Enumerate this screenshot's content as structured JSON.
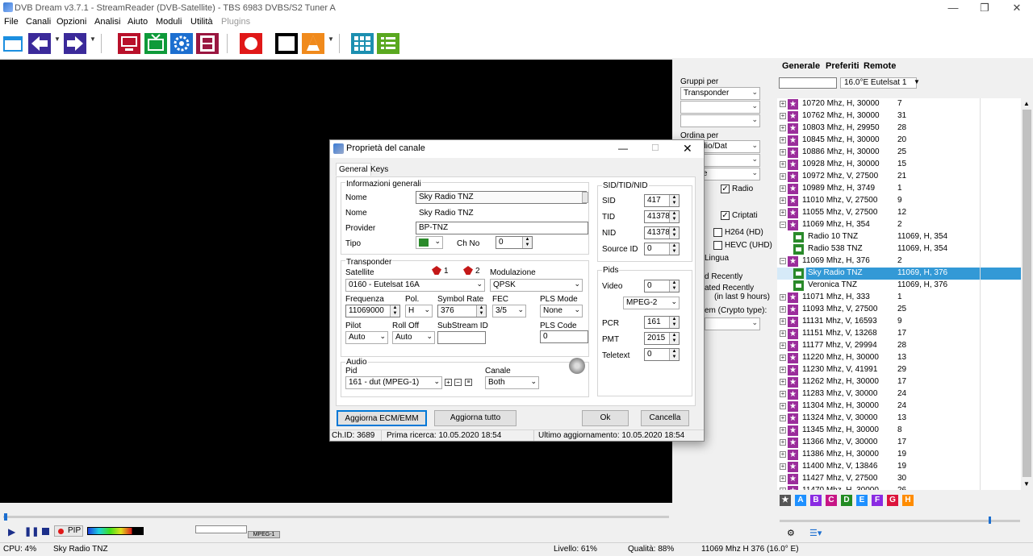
{
  "window": {
    "title": "DVB Dream v3.7.1 - StreamReader (DVB-Satellite) - TBS 6983 DVBS/S2 Tuner A"
  },
  "menu": [
    "File",
    "Canali",
    "Opzioni",
    "Analisi",
    "Aiuto",
    "Moduli",
    "Utilità",
    "Plugins"
  ],
  "midpanel": {
    "gruppi_label": "Gruppi per",
    "gruppi_value": "Transponder",
    "ordina_label": "Ordina per",
    "ordina_value": "V/Radio/Dat",
    "sort2": "canale",
    "radio_label": "Radio",
    "criptati_label": "Criptati",
    "h264_label": "H264 (HD)",
    "hevc_label": "HEVC (UHD)",
    "lingua": "Lingua",
    "added_recently": "d Recently",
    "updated_recently": "ated Recently",
    "last_hours": "(in last 9 hours)",
    "crypto_type": "em (Crypto type):"
  },
  "right_panel": {
    "tabs": [
      "Generale",
      "Preferiti",
      "Remote"
    ],
    "satellite": "16.0°E Eutelsat 1",
    "rows": [
      {
        "type": "tp",
        "name": "10720 Mhz, H, 30000",
        "val": "7"
      },
      {
        "type": "tp",
        "name": "10762 Mhz, H, 30000",
        "val": "31"
      },
      {
        "type": "tp",
        "name": "10803 Mhz, H, 29950",
        "val": "28"
      },
      {
        "type": "tp",
        "name": "10845 Mhz, H, 30000",
        "val": "20"
      },
      {
        "type": "tp",
        "name": "10886 Mhz, H, 30000",
        "val": "25"
      },
      {
        "type": "tp",
        "name": "10928 Mhz, H, 30000",
        "val": "15"
      },
      {
        "type": "tp",
        "name": "10972 Mhz, V, 27500",
        "val": "21"
      },
      {
        "type": "tp",
        "name": "10989 Mhz, H, 3749",
        "val": "1"
      },
      {
        "type": "tp",
        "name": "11010 Mhz, V, 27500",
        "val": "9"
      },
      {
        "type": "tp",
        "name": "11055 Mhz, V, 27500",
        "val": "12"
      },
      {
        "type": "tpo",
        "name": "11069 Mhz, H, 354",
        "val": "2"
      },
      {
        "type": "ch",
        "name": "Radio 10 TNZ",
        "val": "11069, H, 354"
      },
      {
        "type": "ch",
        "name": "Radio 538 TNZ",
        "val": "11069, H, 354"
      },
      {
        "type": "tpo",
        "name": "11069 Mhz, H, 376",
        "val": "2"
      },
      {
        "type": "chs",
        "name": "Sky Radio TNZ",
        "val": "11069, H, 376"
      },
      {
        "type": "ch",
        "name": "Veronica TNZ",
        "val": "11069, H, 376"
      },
      {
        "type": "tp",
        "name": "11071 Mhz, H, 333",
        "val": "1"
      },
      {
        "type": "tp",
        "name": "11093 Mhz, V, 27500",
        "val": "25"
      },
      {
        "type": "tp",
        "name": "11131 Mhz, V, 16593",
        "val": "9"
      },
      {
        "type": "tp",
        "name": "11151 Mhz, V, 13268",
        "val": "17"
      },
      {
        "type": "tp",
        "name": "11177 Mhz, V, 29994",
        "val": "28"
      },
      {
        "type": "tp",
        "name": "11220 Mhz, H, 30000",
        "val": "13"
      },
      {
        "type": "tp",
        "name": "11230 Mhz, V, 41991",
        "val": "29"
      },
      {
        "type": "tp",
        "name": "11262 Mhz, H, 30000",
        "val": "17"
      },
      {
        "type": "tp",
        "name": "11283 Mhz, V, 30000",
        "val": "24"
      },
      {
        "type": "tp",
        "name": "11304 Mhz, H, 30000",
        "val": "24"
      },
      {
        "type": "tp",
        "name": "11324 Mhz, V, 30000",
        "val": "13"
      },
      {
        "type": "tp",
        "name": "11345 Mhz, H, 30000",
        "val": "8"
      },
      {
        "type": "tp",
        "name": "11366 Mhz, V, 30000",
        "val": "17"
      },
      {
        "type": "tp",
        "name": "11386 Mhz, H, 30000",
        "val": "19"
      },
      {
        "type": "tp",
        "name": "11400 Mhz, V, 13846",
        "val": "19"
      },
      {
        "type": "tp",
        "name": "11427 Mhz, V, 27500",
        "val": "30"
      },
      {
        "type": "tp",
        "name": "11470 Mhz, H, 30000",
        "val": "26"
      }
    ],
    "letters": [
      {
        "l": "A",
        "c": "#1e90ff"
      },
      {
        "l": "B",
        "c": "#8a2be2"
      },
      {
        "l": "C",
        "c": "#c71585"
      },
      {
        "l": "D",
        "c": "#228b22"
      },
      {
        "l": "E",
        "c": "#1e90ff"
      },
      {
        "l": "F",
        "c": "#8a2be2"
      },
      {
        "l": "G",
        "c": "#dc143c"
      },
      {
        "l": "H",
        "c": "#ff8c00"
      }
    ]
  },
  "dialog": {
    "title": "Proprietà del canale",
    "tab_general": "General",
    "tab_keys": "Keys",
    "info_title": "Informazioni generali",
    "nome_label": "Nome",
    "nome_value": "Sky Radio TNZ",
    "nome2_label": "Nome",
    "nome2_value": "Sky Radio TNZ",
    "provider_label": "Provider",
    "provider_value": "BP-TNZ",
    "tipo_label": "Tipo",
    "chno_label": "Ch No",
    "chno_value": "0",
    "transponder_title": "Transponder",
    "satellite_label": "Satellite",
    "lnb1": "1",
    "lnb2": "2",
    "modulazione_label": "Modulazione",
    "satellite_value": "0160 - Eutelsat 16A",
    "modulazione_value": "QPSK",
    "freq_label": "Frequenza",
    "freq_value": "11069000",
    "pol_label": "Pol.",
    "pol_value": "H",
    "sr_label": "Symbol Rate",
    "sr_value": "376",
    "fec_label": "FEC",
    "fec_value": "3/5",
    "pls_mode_label": "PLS Mode",
    "pls_mode_value": "None",
    "pilot_label": "Pilot",
    "pilot_value": "Auto",
    "rolloff_label": "Roll Off",
    "rolloff_value": "Auto",
    "substream_label": "SubStream ID",
    "pls_code_label": "PLS Code",
    "pls_code_value": "0",
    "audio_title": "Audio",
    "pid_label": "Pid",
    "audio_pid_value": "161 - dut (MPEG-1)",
    "canale_label": "Canale",
    "canale_value": "Both",
    "sidtid_title": "SID/TID/NID",
    "sid_label": "SID",
    "sid_value": "417",
    "tid_label": "TID",
    "tid_value": "41378",
    "nid_label": "NID",
    "nid_value": "41378",
    "sourceid_label": "Source ID",
    "sourceid_value": "0",
    "pids_title": "Pids",
    "video_label": "Video",
    "video_value": "0",
    "video_codec": "MPEG-2",
    "pcr_label": "PCR",
    "pcr_value": "161",
    "pmt_label": "PMT",
    "pmt_value": "2015",
    "teletext_label": "Teletext",
    "teletext_value": "0",
    "btn_aggiorna_ecm": "Aggiorna ECM/EMM",
    "btn_aggiorna_tutto": "Aggiorna tutto",
    "btn_ok": "Ok",
    "btn_cancella": "Cancella",
    "status_chid": "Ch.ID: 3689",
    "status_prima": "Prima ricerca: 10.05.2020 18:54",
    "status_ultimo": "Ultimo aggiornamento: 10.05.2020 18:54"
  },
  "player": {
    "pip_label": "PIP",
    "codec_badge": "MPEG-1"
  },
  "status": {
    "cpu": "CPU: 4%",
    "channel": "Sky Radio TNZ",
    "livello": "Livello: 61%",
    "qualita": "Qualità: 88%",
    "transponder": "11069 Mhz  H  376  (16.0° E)"
  }
}
